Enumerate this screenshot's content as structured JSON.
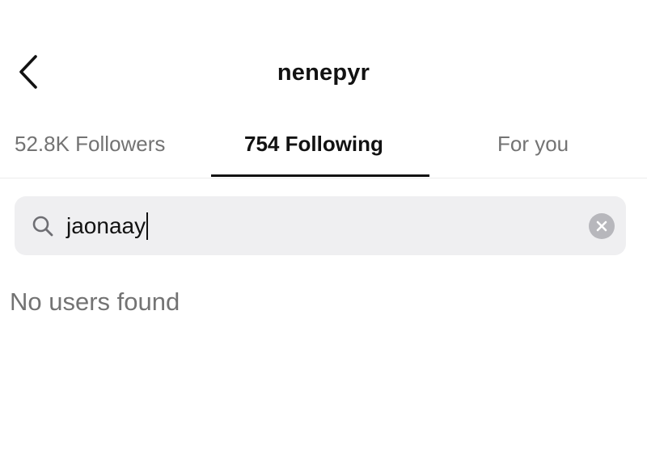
{
  "header": {
    "title": "nenepyr",
    "back_icon": "chevron-left-icon"
  },
  "tabs": [
    {
      "label": "52.8K Followers",
      "active": false
    },
    {
      "label": "754 Following",
      "active": true
    },
    {
      "label": "For you",
      "active": false
    }
  ],
  "search": {
    "value": "jaonaay",
    "icon": "search-icon",
    "clear_icon": "clear-icon"
  },
  "results": {
    "empty_message": "No users found"
  },
  "colors": {
    "text_primary": "#121212",
    "text_secondary": "#737373",
    "search_background": "#efeff1",
    "clear_button": "#b7b7bc"
  }
}
